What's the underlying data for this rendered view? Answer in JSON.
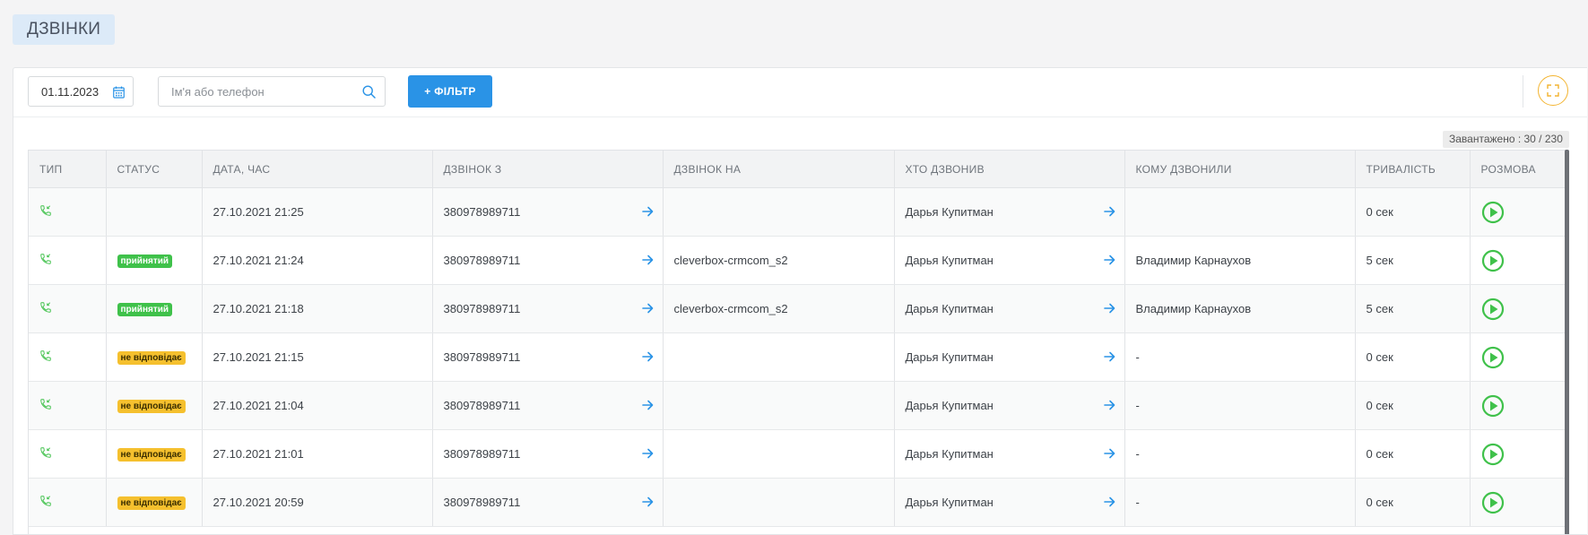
{
  "page": {
    "title": "ДЗВІНКИ"
  },
  "toolbar": {
    "date_value": "01.11.2023",
    "search_placeholder": "Ім'я або телефон",
    "filter_label": "+ ФІЛЬТР"
  },
  "loaded_text": "Завантажено : 30 / 230",
  "colors": {
    "accent": "#2a93e6",
    "accepted": "#3fc14a",
    "no_answer": "#f5c02e",
    "play": "#3fc14a"
  },
  "table": {
    "headers": [
      "ТИП",
      "СТАТУС",
      "ДАТА, ЧАС",
      "ДЗВІНОК З",
      "ДЗВІНОК НА",
      "ХТО ДЗВОНИВ",
      "КОМУ ДЗВОНИЛИ",
      "ТРИВАЛІСТЬ",
      "РОЗМОВА"
    ],
    "rows": [
      {
        "type_icon": "incoming-call-icon",
        "status": "",
        "status_kind": "",
        "datetime": "27.10.2021 21:25",
        "from": "380978989711",
        "to": "",
        "caller": "Дарья Купитман",
        "callee": "",
        "duration": "0 сек"
      },
      {
        "type_icon": "incoming-call-icon",
        "status": "прийнятий",
        "status_kind": "accepted",
        "datetime": "27.10.2021 21:24",
        "from": "380978989711",
        "to": "cleverbox-crmcom_s2",
        "caller": "Дарья Купитман",
        "callee": "Владимир Карнаухов",
        "duration": "5 сек"
      },
      {
        "type_icon": "incoming-call-icon",
        "status": "прийнятий",
        "status_kind": "accepted",
        "datetime": "27.10.2021 21:18",
        "from": "380978989711",
        "to": "cleverbox-crmcom_s2",
        "caller": "Дарья Купитман",
        "callee": "Владимир Карнаухов",
        "duration": "5 сек"
      },
      {
        "type_icon": "incoming-call-icon",
        "status": "не відповідає",
        "status_kind": "noanswer",
        "datetime": "27.10.2021 21:15",
        "from": "380978989711",
        "to": "",
        "caller": "Дарья Купитман",
        "callee": "-",
        "duration": "0 сек"
      },
      {
        "type_icon": "incoming-call-icon",
        "status": "не відповідає",
        "status_kind": "noanswer",
        "datetime": "27.10.2021 21:04",
        "from": "380978989711",
        "to": "",
        "caller": "Дарья Купитман",
        "callee": "-",
        "duration": "0 сек"
      },
      {
        "type_icon": "incoming-call-icon",
        "status": "не відповідає",
        "status_kind": "noanswer",
        "datetime": "27.10.2021 21:01",
        "from": "380978989711",
        "to": "",
        "caller": "Дарья Купитман",
        "callee": "-",
        "duration": "0 сек"
      },
      {
        "type_icon": "incoming-call-icon",
        "status": "не відповідає",
        "status_kind": "noanswer",
        "datetime": "27.10.2021 20:59",
        "from": "380978989711",
        "to": "",
        "caller": "Дарья Купитман",
        "callee": "-",
        "duration": "0 сек"
      }
    ]
  }
}
